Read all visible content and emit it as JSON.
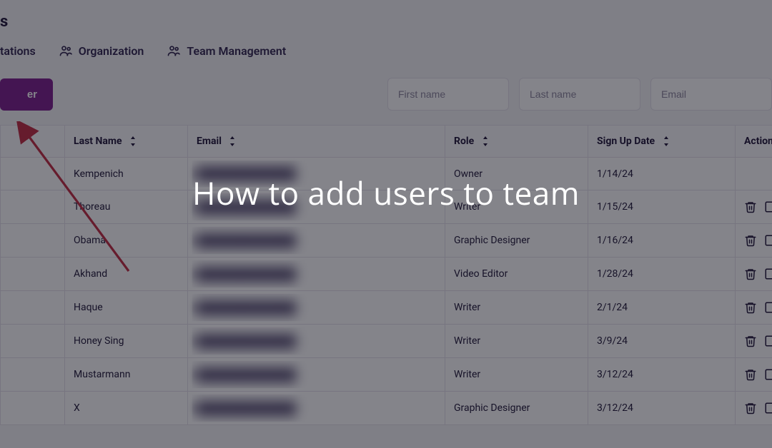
{
  "header": {
    "title_suffix": "s"
  },
  "tabs": {
    "invitations_suffix": "tations",
    "organization": "Organization",
    "team_management": "Team Management"
  },
  "toolbar": {
    "add_button_suffix": "er",
    "filters": {
      "first_name_placeholder": "First name",
      "last_name_placeholder": "Last name",
      "email_placeholder": "Email"
    }
  },
  "table": {
    "columns": {
      "last_name": "Last Name",
      "email": "Email",
      "role": "Role",
      "sign_up_date": "Sign Up Date",
      "actions": "Action"
    },
    "rows": [
      {
        "last_name": "Kempenich",
        "email": "",
        "role": "Owner",
        "date": "1/14/24",
        "has_actions": false
      },
      {
        "last_name": "Thoreau",
        "email": "",
        "role": "Writer",
        "date": "1/15/24",
        "has_actions": true
      },
      {
        "last_name": "Obama",
        "email": "",
        "role": "Graphic Designer",
        "date": "1/16/24",
        "has_actions": true
      },
      {
        "last_name": "Akhand",
        "email": "",
        "role": "Video Editor",
        "date": "1/28/24",
        "has_actions": true
      },
      {
        "last_name": "Haque",
        "email": "",
        "role": "Writer",
        "date": "2/1/24",
        "has_actions": true
      },
      {
        "last_name": "Honey Sing",
        "email": "",
        "role": "Writer",
        "date": "3/9/24",
        "has_actions": true
      },
      {
        "last_name": "Mustarmann",
        "email": "",
        "role": "Writer",
        "date": "3/12/24",
        "has_actions": true
      },
      {
        "last_name": "X",
        "email": "",
        "role": "Graphic Designer",
        "date": "3/12/24",
        "has_actions": true
      }
    ]
  },
  "overlay": {
    "title": "How to add users to team"
  },
  "colors": {
    "accent": "#7a178a",
    "arrow": "#c0263e"
  }
}
